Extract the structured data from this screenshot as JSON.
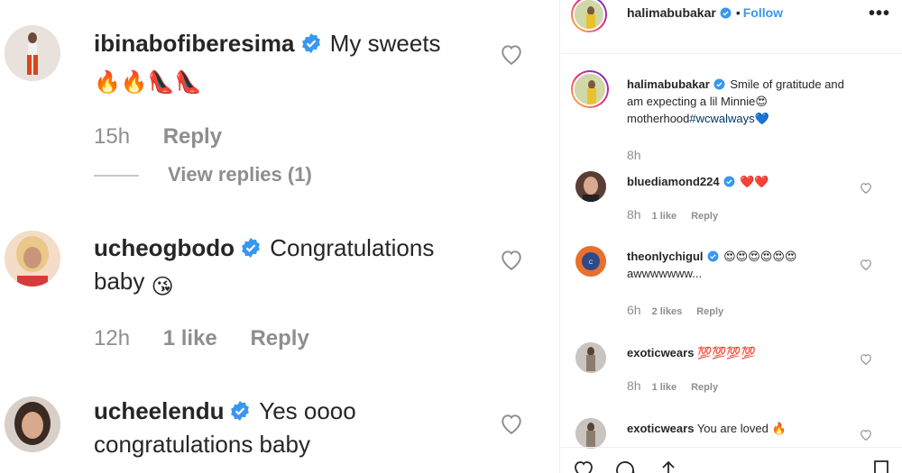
{
  "left_comments": [
    {
      "username": "ibinabofiberesima",
      "text": "My sweets",
      "emojis": "🔥🔥👠👠",
      "time": "15h",
      "likes": "",
      "reply": "Reply",
      "view_replies": "View replies (1)"
    },
    {
      "username": "ucheogbodo",
      "text": "Congratulations baby",
      "emojis": "😘",
      "time": "12h",
      "likes": "1 like",
      "reply": "Reply"
    },
    {
      "username": "ucheelendu",
      "text": "Yes oooo congratulations baby",
      "time": "",
      "likes": "",
      "reply": ""
    }
  ],
  "post": {
    "header": {
      "username": "halimabubakar",
      "separator": "•",
      "follow": "Follow",
      "more": "•••"
    },
    "caption": {
      "username": "halimabubakar",
      "text": "Smile of gratitude and am expecting a lil Minnie😍 motherhood",
      "hashtag": "#wcwalways",
      "trailing": "💙",
      "time": "8h"
    },
    "comments": [
      {
        "username": "bluediamond224",
        "verified": true,
        "text": "❤️❤️",
        "time": "8h",
        "likes": "1 like",
        "reply": "Reply"
      },
      {
        "username": "theonlychigul",
        "verified": true,
        "text": "😍😍😍😍😍😍awwwwwww...",
        "time": "6h",
        "likes": "2 likes",
        "reply": "Reply"
      },
      {
        "username": "exoticwears",
        "verified": false,
        "text": "💯💯💯💯",
        "time": "8h",
        "likes": "1 like",
        "reply": "Reply"
      },
      {
        "username": "exoticwears",
        "verified": false,
        "text": "You are loved 🔥",
        "time": "",
        "likes": "",
        "reply": ""
      }
    ]
  },
  "colors": {
    "text": "#262626",
    "muted": "#8e8e8e",
    "link_blue": "#3897f0",
    "hashtag": "#003569",
    "verified": "#3897f0",
    "border": "#efefef"
  },
  "icons": [
    "verified-badge-icon",
    "heart-icon",
    "comment-icon",
    "share-icon",
    "bookmark-icon",
    "more-options-icon"
  ]
}
